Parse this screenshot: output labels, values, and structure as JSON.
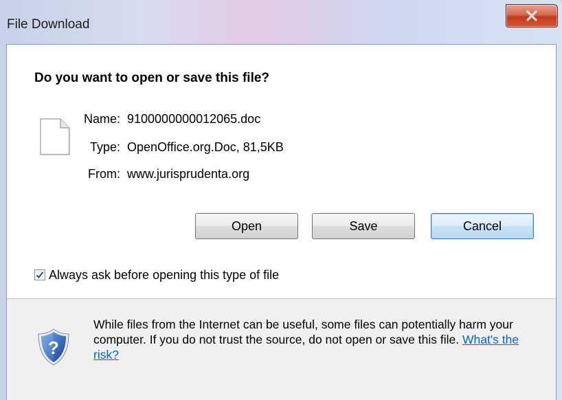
{
  "window": {
    "title": "File Download",
    "close_glyph": "X"
  },
  "dialog": {
    "question": "Do you want to open or save this file?",
    "file": {
      "icon": "document-icon",
      "name_label": "Name:",
      "name_value": "9100000000012065.doc",
      "type_label": "Type:",
      "type_value": "OpenOffice.org.Doc, 81,5KB",
      "from_label": "From:",
      "from_value": "www.jurisprudenta.org"
    },
    "buttons": {
      "open": "Open",
      "save": "Save",
      "cancel": "Cancel"
    },
    "always_ask": {
      "label": "Always ask before opening this type of file",
      "checked": true
    },
    "warning": {
      "icon": "shield-question-icon",
      "text": "While files from the Internet can be useful, some files can potentially harm your computer. If you do not trust the source, do not open or save this file. ",
      "link": "What's the risk?"
    }
  },
  "colors": {
    "link": "#0066cc",
    "close_button": "#c2391a",
    "default_button_border": "#3c7fb1"
  }
}
